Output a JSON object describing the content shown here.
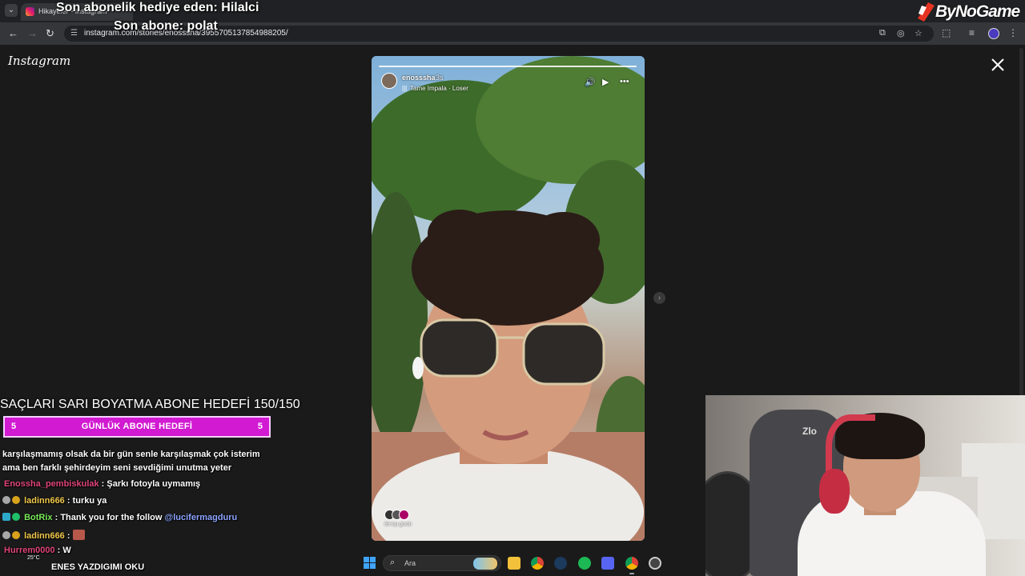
{
  "browser": {
    "tab_title": "Hikayeler • Instagram",
    "url": "instagram.com/stories/enosssha/3955705137854988205/",
    "nav": {
      "back": "←",
      "forward": "→",
      "reload": "↻"
    },
    "icons": [
      "install-icon",
      "eye-off-icon",
      "bookmark-star-icon",
      "extensions-icon",
      "media-controls-icon",
      "profile-avatar",
      "more-menu-icon"
    ]
  },
  "overlay": {
    "last_gift": "Son abonelik hediye eden: Hilalci",
    "last_sub": "Son abone: polat",
    "sponsor": "ByNoGame"
  },
  "instagram": {
    "logo": "Instagram",
    "close": "✕",
    "story": {
      "username": "enosssha",
      "time": "3s",
      "music": "Tame Impala · Loser",
      "viewers": "65 kişi gördü"
    }
  },
  "goal": {
    "title": "SAÇLARI SARI BOYATMA ABONE HEDEFİ 150/150",
    "left": "5",
    "label": "GÜNLÜK ABONE HEDEFİ",
    "right": "5"
  },
  "chat": {
    "alert_line1": "karşılaşmamış olsak da bir gün senle karşılaşmak çok isterim",
    "alert_line2": "ama ben farklı şehirdeyim seni sevdiğimi unutma yeter",
    "messages": [
      {
        "user": "Enossha_pembiskulak",
        "text": "Şarkı fotoyla uymamış",
        "color": "#e0457b"
      },
      {
        "user": "ladinn666",
        "text": "turku ya",
        "color": "#f2c94c"
      },
      {
        "user": "BotRix",
        "text": "Thank you for the follow ",
        "mention": "@lucifermagduru",
        "color": "#7bea5b",
        "mention_color": "#8ea4ff"
      },
      {
        "user": "ladinn666",
        "text": "",
        "color": "#f2c94c"
      },
      {
        "user": "Hurrem0000",
        "text": "W",
        "color": "#e0457b"
      },
      {
        "user": "",
        "text": "ENES YAZDIGIMI OKU",
        "color": "#ffffff"
      }
    ]
  },
  "taskbar": {
    "weather": "25°C",
    "search_placeholder": "Ara"
  }
}
